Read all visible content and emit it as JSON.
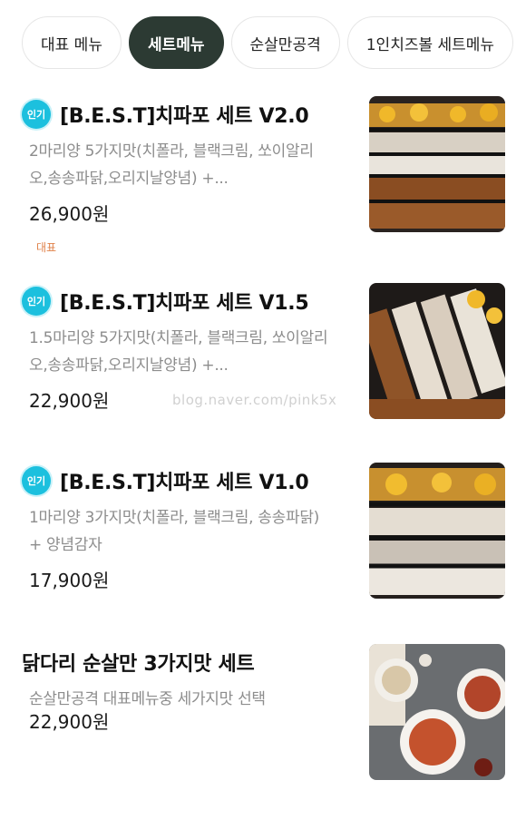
{
  "tabs": [
    "대표 메뉴",
    "세트메뉴",
    "순살만공격",
    "1인치즈볼 세트메뉴"
  ],
  "active_tab_index": 1,
  "badge_label": "인기",
  "items": [
    {
      "name": "[B.E.S.T]치파포 세트 V2.0",
      "desc": "2마리양 5가지맛(치폴라, 블랙크림, 쏘이알리오,송송파닭,오리지날양념) +...",
      "price": "26,900원",
      "tag": "대표",
      "popular": true
    },
    {
      "name": "[B.E.S.T]치파포 세트 V1.5",
      "desc": "1.5마리양 5가지맛(치폴라, 블랙크림, 쏘이알리오,송송파닭,오리지날양념) +...",
      "price": "22,900원",
      "popular": true
    },
    {
      "name": "[B.E.S.T]치파포 세트 V1.0",
      "desc": "1마리양 3가지맛(치폴라, 블랙크림, 송송파닭) + 양념감자",
      "price": "17,900원",
      "popular": true
    },
    {
      "name": "닭다리 순살만 3가지맛 세트",
      "desc": "순살만공격 대표메뉴중 세가지맛 선택",
      "price": "22,900원",
      "popular": false
    }
  ],
  "watermark": "blog.naver.com/pink5x",
  "colors": {
    "active_tab": "#2c3a33",
    "badge": "#1cc0de",
    "tag": "#e0824a",
    "desc": "#8d8d8d"
  }
}
